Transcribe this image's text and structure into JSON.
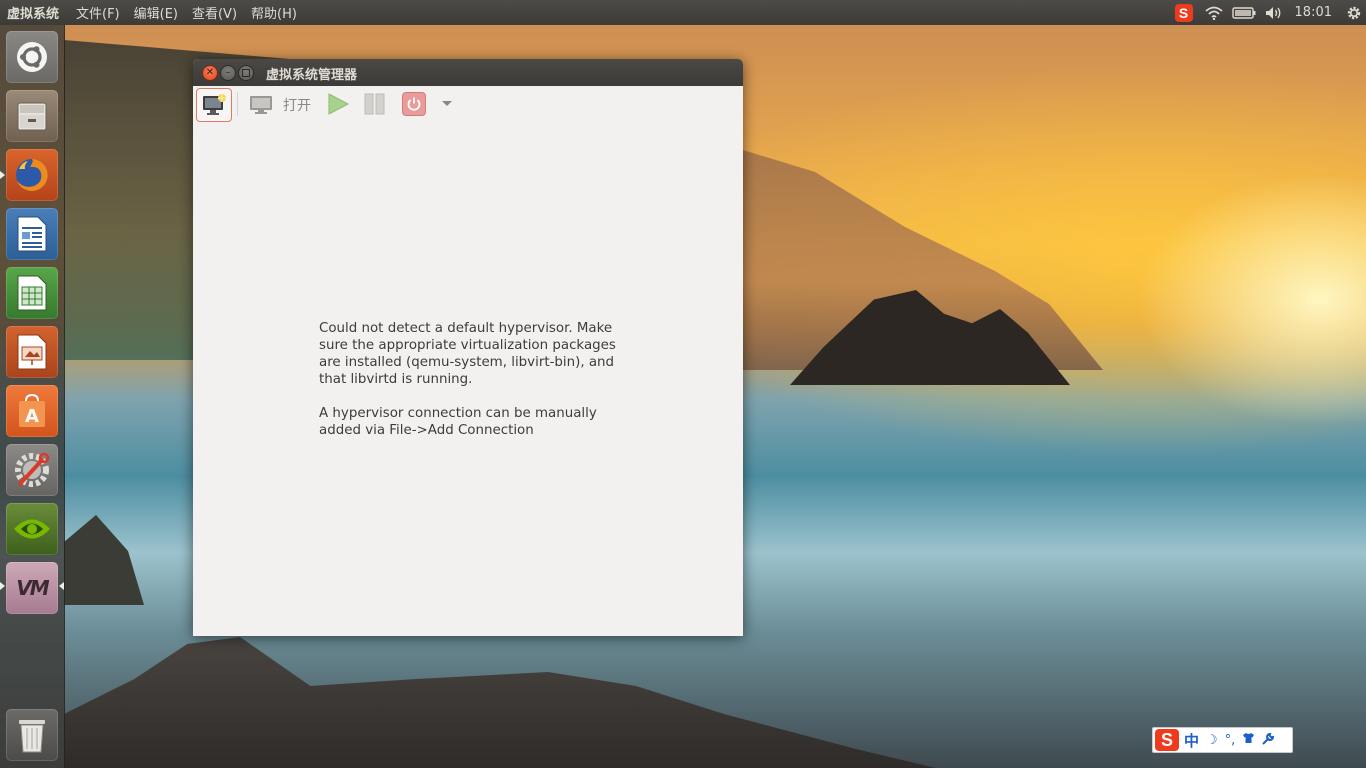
{
  "top_panel": {
    "app_title": "虚拟系统",
    "menus": [
      "文件(F)",
      "编辑(E)",
      "查看(V)",
      "帮助(H)"
    ],
    "clock": "18:01",
    "tray_ime_label": "S"
  },
  "launcher": {
    "items": [
      {
        "name": "ubuntu-dash"
      },
      {
        "name": "files"
      },
      {
        "name": "firefox"
      },
      {
        "name": "libreoffice-writer"
      },
      {
        "name": "libreoffice-calc"
      },
      {
        "name": "libreoffice-impress"
      },
      {
        "name": "ubuntu-software-center"
      },
      {
        "name": "system-settings"
      },
      {
        "name": "nvidia-settings"
      },
      {
        "name": "virt-manager",
        "label": "VM"
      },
      {
        "name": "trash"
      }
    ]
  },
  "window": {
    "title": "虚拟系统管理器",
    "toolbar": {
      "open_label": "打开"
    },
    "message": {
      "paragraph1": "Could not detect a default hypervisor. Make sure the appropriate virtualization packages are installed (qemu-system, libvirt-bin), and that libvirtd is running.",
      "paragraph2": "A hypervisor connection can be manually added via File->Add Connection"
    }
  },
  "ime_bar": {
    "logo": "S",
    "mode": "中",
    "icons": [
      "moon-icon",
      "punctuation-icon",
      "shirt-icon",
      "wrench-icon"
    ]
  }
}
